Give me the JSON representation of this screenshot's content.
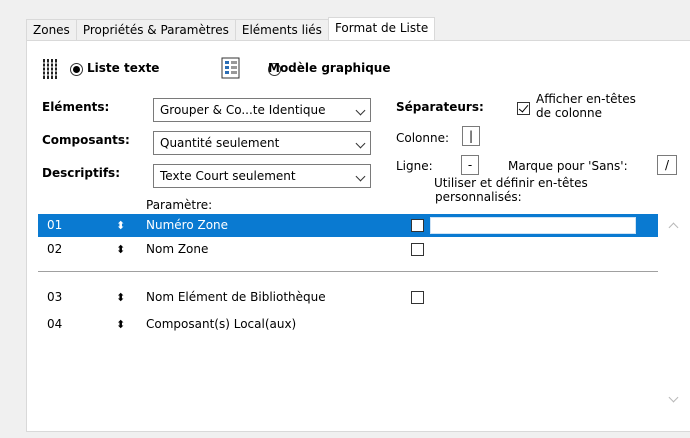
{
  "tabs": [
    "Zones",
    "Propriétés & Paramètres",
    "Eléments liés",
    "Format de Liste"
  ],
  "mode": {
    "text_list_label": "Liste texte",
    "graphic_label": "Modèle graphique",
    "selected": "text_list"
  },
  "fields": {
    "elements_label": "Eléments:",
    "elements_value": "Grouper & Co...te Identique",
    "components_label": "Composants:",
    "components_value": "Quantité seulement",
    "descriptives_label": "Descriptifs:",
    "descriptives_value": "Texte Court seulement"
  },
  "separators": {
    "title": "Séparateurs:",
    "column_label": "Colonne:",
    "column_value": "|",
    "line_label": "Ligne:",
    "line_value": "-",
    "without_label": "Marque pour 'Sans':",
    "without_value": "/"
  },
  "show_headers": {
    "label_line1": "Afficher en-têtes",
    "label_line2": "de colonne",
    "checked": true
  },
  "headers": {
    "parameter": "Paramètre:",
    "custom_line1": "Utiliser et définir en-têtes",
    "custom_line2": "personnalisés:"
  },
  "rows": [
    {
      "num": "01",
      "name": "Numéro Zone",
      "selected": true
    },
    {
      "num": "02",
      "name": "Nom Zone",
      "selected": false
    },
    {
      "num": "03",
      "name": "Nom Elément de Bibliothèque",
      "selected": false
    },
    {
      "num": "04",
      "name": "Composant(s) Local(aux)",
      "selected": false
    }
  ],
  "colors": {
    "selection": "#0a7ad1",
    "window_bg": "#f0f0f0",
    "panel_bg": "#ffffff"
  }
}
